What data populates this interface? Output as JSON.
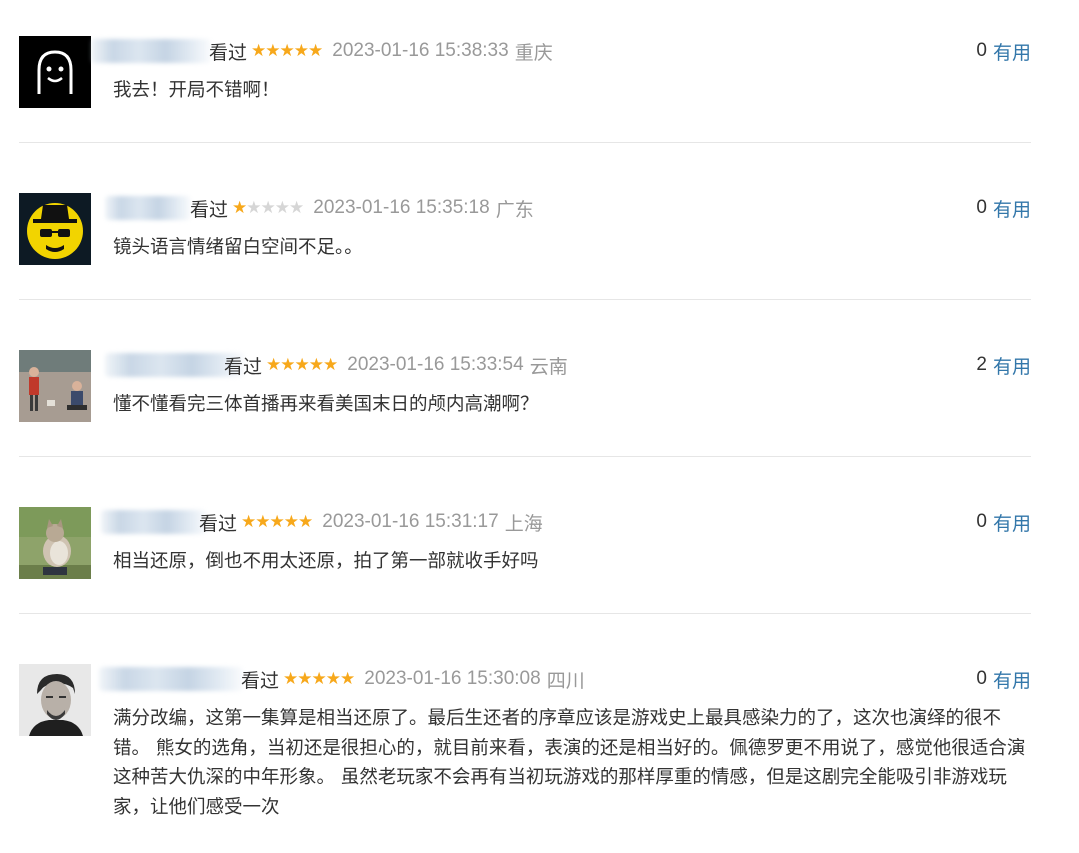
{
  "comments": [
    {
      "watched_label": "看过",
      "rating": 5,
      "time": "2023-01-16 15:38:33",
      "location": "重庆",
      "vote_count": "0",
      "useful_label": "有用",
      "text": "我去！开局不错啊！",
      "avatar_icon": "ghost-face-icon"
    },
    {
      "watched_label": "看过",
      "rating": 1,
      "time": "2023-01-16 15:35:18",
      "location": "广东",
      "vote_count": "0",
      "useful_label": "有用",
      "text": "镜头语言情绪留白空间不足。。",
      "avatar_icon": "heisenberg-face-icon"
    },
    {
      "watched_label": "看过",
      "rating": 5,
      "time": "2023-01-16 15:33:54",
      "location": "云南",
      "vote_count": "2",
      "useful_label": "有用",
      "text": "懂不懂看完三体首播再来看美国末日的颅内高潮啊？",
      "avatar_icon": "street-kids-photo"
    },
    {
      "watched_label": "看过",
      "rating": 5,
      "time": "2023-01-16 15:31:17",
      "location": "上海",
      "vote_count": "0",
      "useful_label": "有用",
      "text": "相当还原，倒也不用太还原，拍了第一部就收手好吗",
      "avatar_icon": "cat-photo"
    },
    {
      "watched_label": "看过",
      "rating": 5,
      "time": "2023-01-16 15:30:08",
      "location": "四川",
      "vote_count": "0",
      "useful_label": "有用",
      "text": "满分改编，这第一集算是相当还原了。最后生还者的序章应该是游戏史上最具感染力的了，这次也演绎的很不错。 熊女的选角，当初还是很担心的，就目前来看，表演的还是相当好的。佩德罗更不用说了，感觉他很适合演这种苦大仇深的中年形象。 虽然老玩家不会再有当初玩游戏的那样厚重的情感，但是这剧完全能吸引非游戏玩家，让他们感受一次",
      "avatar_icon": "man-portrait-photo"
    }
  ],
  "colors": {
    "star_on": "#f7a81b",
    "star_off": "#d6d6d6",
    "useful_link": "#3377aa",
    "meta_gray": "#999999"
  }
}
